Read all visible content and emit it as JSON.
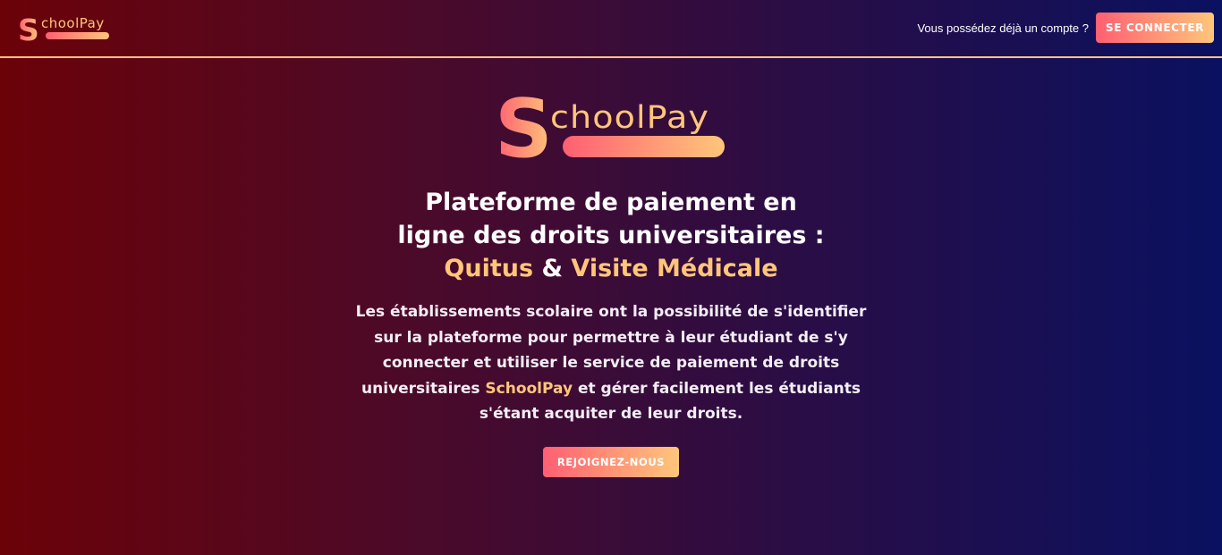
{
  "brand": {
    "logo_initial": "S",
    "logo_rest": "choolPay",
    "colors": {
      "gradient_start": "#ff5f72",
      "gradient_end": "#ffc67a",
      "accent_text": "#ffc67a",
      "nav_border": "#ffc38a",
      "bg_left": "#6b0208",
      "bg_right": "#0a1160"
    }
  },
  "header": {
    "account_question": "Vous possédez déjà un compte ?",
    "login_label": "SE CONNECTER"
  },
  "hero": {
    "headline_line1": "Plateforme de paiement en",
    "headline_line2": "ligne des droits universitaires :",
    "accent_quitus": "Quitus",
    "ampersand": " & ",
    "accent_visite": "Visite Médicale",
    "description_part1": "Les établissements scolaire ont la possibilité de s'identifier sur la plateforme pour permettre à leur étudiant de s'y connecter et utiliser le service de paiement de droits universitaires ",
    "description_brand": "SchoolPay",
    "description_part2": " et gérer facilement les étudiants s'étant acquiter de leur droits.",
    "join_label": "REJOIGNEZ-NOUS"
  }
}
